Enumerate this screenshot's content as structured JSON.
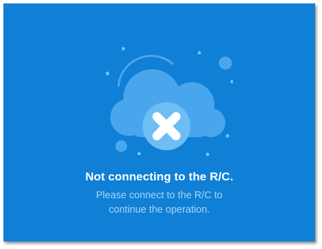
{
  "dialog": {
    "title": "Not connecting to the R/C.",
    "message_line1": "Please connect to the R/C to",
    "message_line2": "continue the operation.",
    "icon": "cloud-disconnected-icon",
    "colors": {
      "background": "#1080d6",
      "title": "#ffffff",
      "message": "#a8d4f6",
      "cloud": "#4aa6ec",
      "badge": "#6dbef5",
      "cross": "#ffffff"
    }
  }
}
